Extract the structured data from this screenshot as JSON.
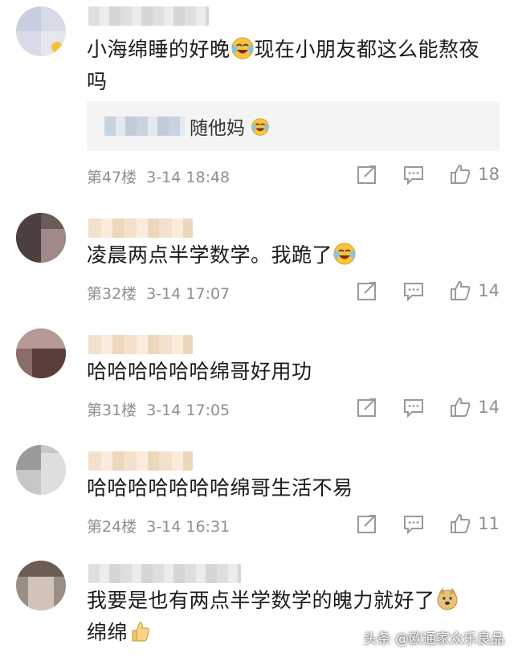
{
  "comments": [
    {
      "text": "小海绵睡的好晚",
      "text_after_emoji": "现在小朋友都这么能熬夜吗",
      "emoji": "laugh-cry-icon",
      "subreply": {
        "text": "随他妈",
        "emoji": "laugh-cry-icon"
      },
      "floor": "第47楼",
      "time": "3-14 18:48",
      "likes": "18"
    },
    {
      "text": "凌晨两点半学数学。我跪了",
      "emoji": "laugh-cry-icon",
      "floor": "第32楼",
      "time": "3-14 17:07",
      "likes": "14"
    },
    {
      "text": "哈哈哈哈哈哈绵哥好用功",
      "floor": "第31楼",
      "time": "3-14 17:05",
      "likes": "14"
    },
    {
      "text": "哈哈哈哈哈哈哈绵哥生活不易",
      "floor": "第24楼",
      "time": "3-14 16:31",
      "likes": "11"
    },
    {
      "text": "我要是也有两点半学数学的魄力就好了",
      "emoji": "doge-icon",
      "text_line2": "绵绵",
      "emoji2": "thumbs-up-icon"
    }
  ],
  "watermark": "头条 @欧通家众乐良品",
  "colors": {
    "meta": "#8f8f8f",
    "text": "#1b1b1b",
    "subreply_bg": "#f4f4f4"
  }
}
